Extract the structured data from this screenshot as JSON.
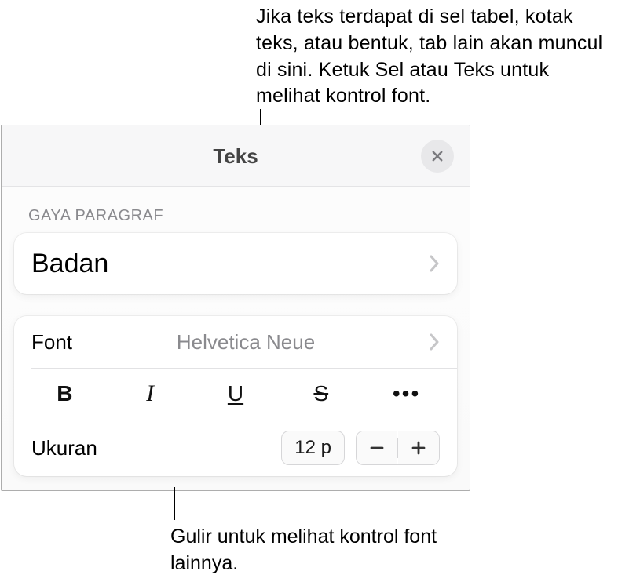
{
  "callouts": {
    "top": "Jika teks terdapat di sel tabel, kotak teks, atau bentuk, tab lain akan muncul di sini. Ketuk Sel atau Teks untuk melihat kontrol font.",
    "bottom": "Gulir untuk melihat kontrol font lainnya."
  },
  "panel": {
    "title": "Teks",
    "section_label": "GAYA PARAGRAF",
    "paragraph_style": "Badan",
    "font_label": "Font",
    "font_value": "Helvetica Neue",
    "styles": {
      "bold": "B",
      "italic": "I",
      "underline": "U",
      "strike": "S",
      "more": "•••"
    },
    "size_label": "Ukuran",
    "size_value": "12 p"
  }
}
